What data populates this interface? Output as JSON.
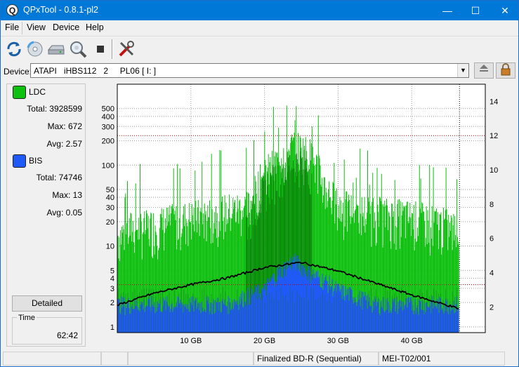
{
  "window": {
    "title": "QPxTool - 0.8.1-pl2",
    "icon_letter": "Q",
    "minimize_glyph": "—",
    "maximize_glyph": "☐",
    "close_glyph": "✕"
  },
  "menu": [
    "File",
    "View",
    "Device",
    "Help"
  ],
  "toolbar": {
    "icons": [
      "refresh-icon",
      "disc-scan-icon",
      "drive-icon",
      "magnifier-icon",
      "stop-icon",
      "tools-icon"
    ]
  },
  "device": {
    "label": "Device:",
    "value": "ATAPI   iHBS112   2     PL06 [ I: ]",
    "dropdown_glyph": "▼",
    "eject_icon": "eject-icon",
    "lock_icon": "lock-icon"
  },
  "legend": {
    "ldc": {
      "name": "LDC",
      "color": "#10c010",
      "total": "Total: 3928599",
      "max": "Max: 672",
      "avg": "Avg: 2.57"
    },
    "bis": {
      "name": "BIS",
      "color": "#1f5af7",
      "total": "Total: 74746",
      "max": "Max: 13",
      "avg": "Avg: 0.05"
    }
  },
  "detailed_button": "Detailed",
  "time": {
    "label": "Time",
    "value": "62:42"
  },
  "chart_data": {
    "type": "bar",
    "title": "",
    "xlabel": "",
    "ylabel": "",
    "x_tick_labels": [
      "10 GB",
      "20 GB",
      "30 GB",
      "40 GB"
    ],
    "x_tick_values": [
      10,
      20,
      30,
      40
    ],
    "xlim": [
      0,
      50
    ],
    "left_axis_scale": "log",
    "left_tick_labels": [
      "1",
      "2",
      "3",
      "4",
      "5",
      "10",
      "20",
      "30",
      "40",
      "50",
      "100",
      "200",
      "300",
      "400",
      "500"
    ],
    "left_tick_values": [
      1,
      2,
      3,
      4,
      5,
      10,
      20,
      30,
      40,
      50,
      100,
      200,
      300,
      400,
      500
    ],
    "ylim_left": [
      0.85,
      1000
    ],
    "right_tick_labels": [
      "2",
      "4",
      "6",
      "8",
      "10",
      "12",
      "14"
    ],
    "right_tick_values": [
      2,
      4,
      6,
      8,
      10,
      12,
      14
    ],
    "ylim_right": [
      0.5,
      15
    ],
    "data_end_gb": 46.4,
    "grid": true,
    "series": [
      {
        "name": "LDC",
        "color": "#10c010",
        "x_gb": [
          0,
          2,
          4,
          6,
          8,
          10,
          12,
          14,
          16,
          18,
          20,
          22,
          24,
          26,
          28,
          30,
          32,
          34,
          36,
          38,
          40,
          42,
          44,
          46.4
        ],
        "values": [
          14,
          18,
          18,
          20,
          22,
          24,
          25,
          28,
          30,
          32,
          80,
          120,
          180,
          150,
          60,
          32,
          30,
          28,
          26,
          25,
          24,
          22,
          20,
          16
        ]
      },
      {
        "name": "BIS",
        "color": "#1f5af7",
        "x_gb": [
          0,
          5,
          10,
          15,
          20,
          22,
          24,
          26,
          30,
          35,
          40,
          46.4
        ],
        "values": [
          2,
          2,
          2,
          2,
          3,
          5,
          7,
          5,
          3,
          2,
          2,
          2
        ]
      },
      {
        "name": "Speed",
        "color": "#000000",
        "axis": "right",
        "x_gb": [
          0,
          5,
          10,
          15,
          20,
          25,
          30,
          35,
          40,
          46.4
        ],
        "values": [
          2.1,
          2.8,
          3.3,
          3.7,
          4.3,
          4.6,
          4.1,
          3.4,
          2.7,
          1.9
        ]
      }
    ]
  },
  "status": {
    "cell1": "",
    "cell2": "",
    "cell3": "",
    "disc_type": "Finalized BD-R (Sequential)",
    "media_id": "MEI-T02/001"
  }
}
